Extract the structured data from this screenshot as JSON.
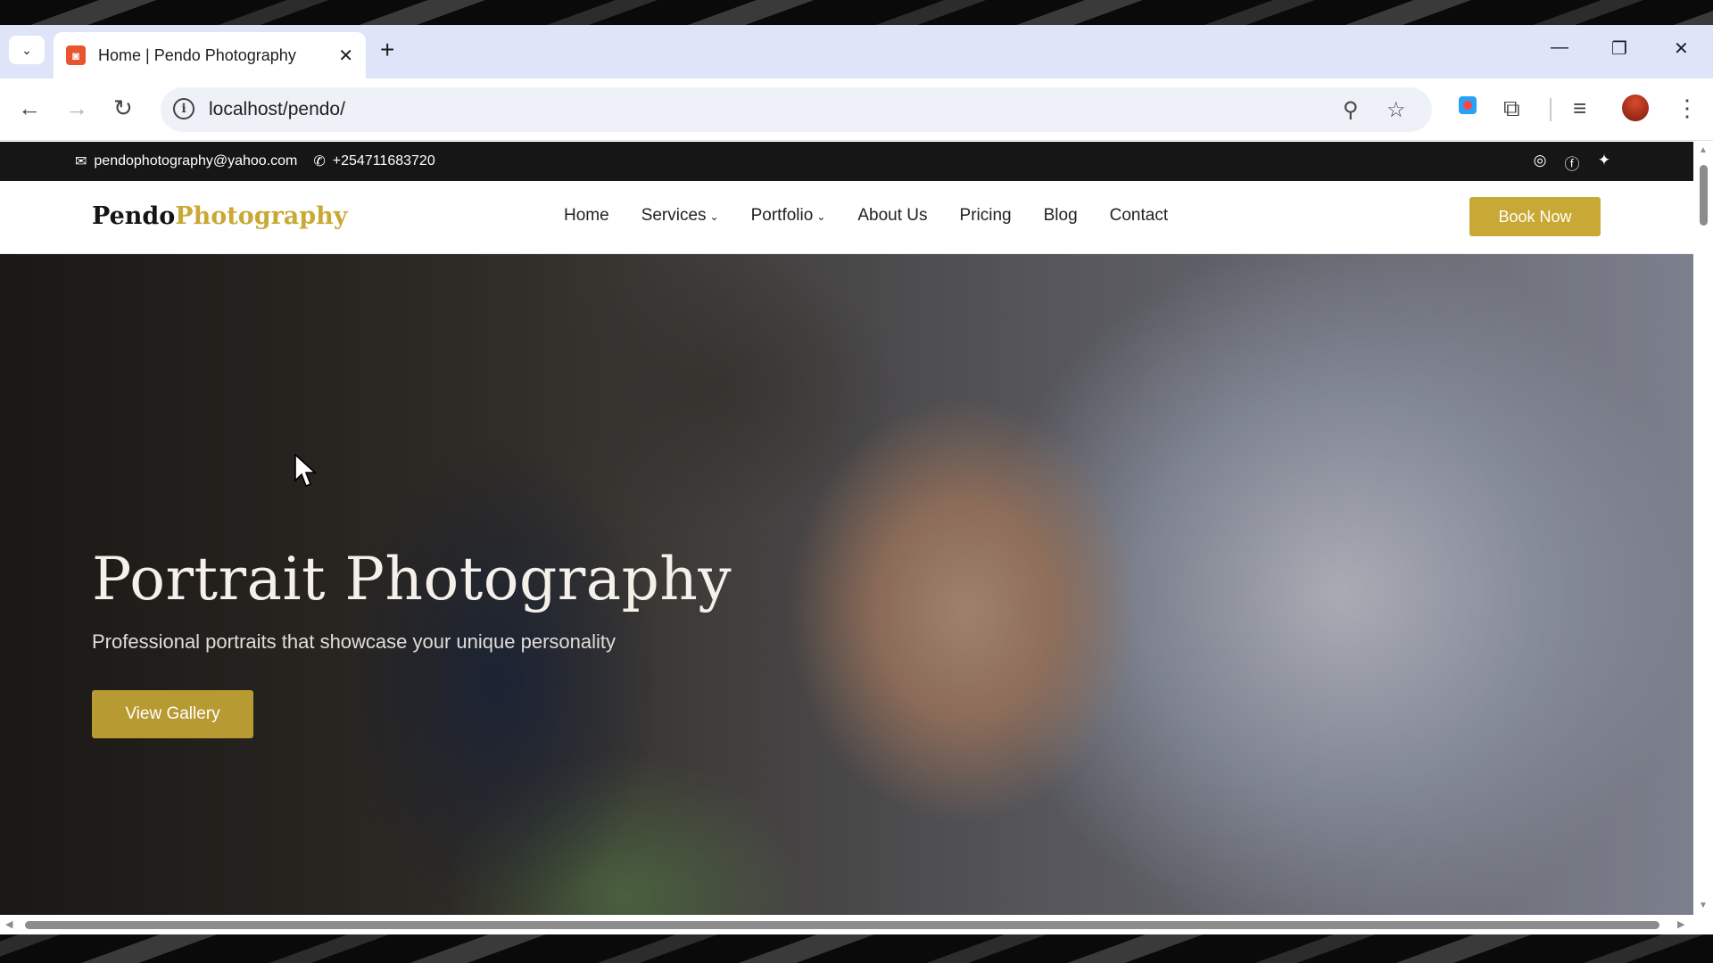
{
  "browser": {
    "tab_title": "Home | Pendo Photography",
    "url": "localhost/pendo/"
  },
  "topbar": {
    "email": "pendophotography@yahoo.com",
    "phone": "+254711683720",
    "social": [
      "instagram-icon",
      "facebook-icon",
      "twitter-icon"
    ]
  },
  "nav": {
    "logo_part1": "Pendo",
    "logo_part2": "Photography",
    "items": {
      "home": "Home",
      "services": "Services",
      "portfolio": "Portfolio",
      "about": "About Us",
      "pricing": "Pricing",
      "blog": "Blog",
      "contact": "Contact"
    },
    "book_now": "Book Now"
  },
  "hero": {
    "title": "Portrait Photography",
    "subtitle": "Professional portraits that showcase your unique personality",
    "cta": "View Gallery"
  },
  "colors": {
    "accent": "#c9a935",
    "topbar_bg": "#161616",
    "tabstrip_bg": "#dfe5f9"
  }
}
